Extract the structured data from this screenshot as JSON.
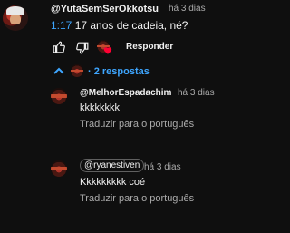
{
  "top_comment": {
    "handle": "@YutaSemSerOkkotsu",
    "time": "há 3 dias",
    "timestamp_link": "1:17",
    "text": "17 anos de cadeia, né?",
    "reply_label": "Responder"
  },
  "replies_toggle": {
    "label": "· 2 respostas"
  },
  "replies": [
    {
      "handle": "@MelhorEspadachim",
      "time": "há 3 dias",
      "text": "kkkkkkkk",
      "translate": "Traduzir para o português"
    },
    {
      "mention": "@ryanestiven",
      "time": "há 3 dias",
      "text": "Kkkkkkkkk coé",
      "translate": "Traduzir para o português"
    }
  ],
  "colors": {
    "background": "#0f0f0f",
    "link": "#3ea6ff",
    "heart": "#ff0033"
  }
}
